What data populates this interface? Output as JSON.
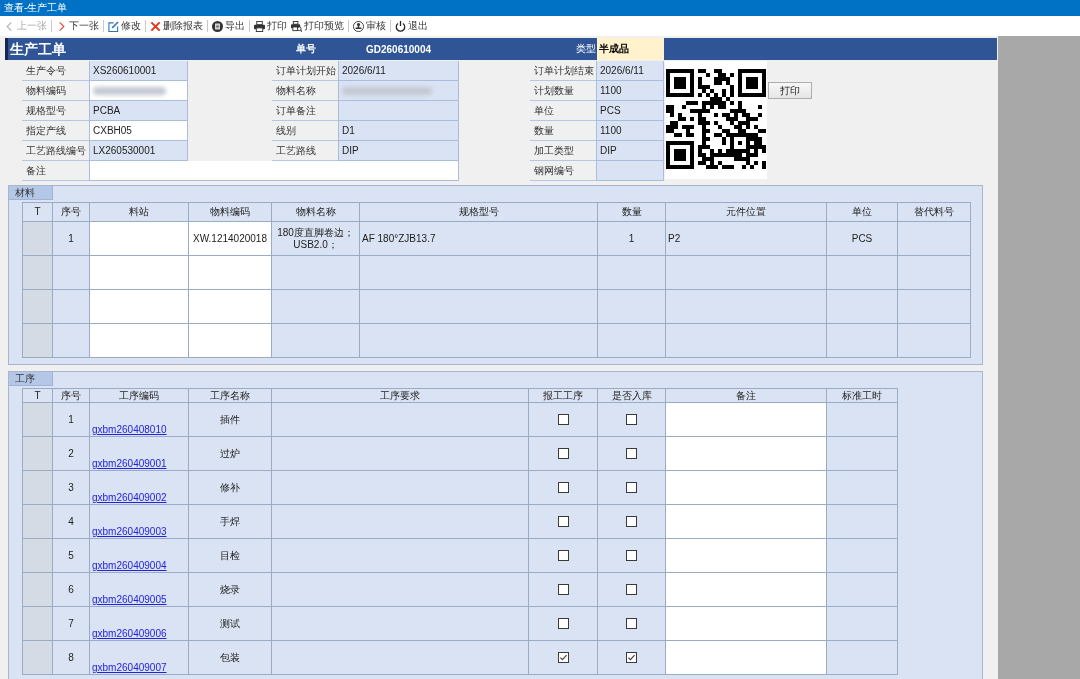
{
  "window": {
    "title": "查看-生产工单"
  },
  "toolbar": [
    {
      "label": "上一张",
      "disabled": true
    },
    {
      "label": "下一张",
      "disabled": false
    },
    {
      "label": "修改",
      "disabled": false
    },
    {
      "label": "删除报表",
      "disabled": false
    },
    {
      "label": "导出",
      "disabled": false
    },
    {
      "label": "打印",
      "disabled": false
    },
    {
      "label": "打印预览",
      "disabled": false
    },
    {
      "label": "审核",
      "disabled": false
    },
    {
      "label": "退出",
      "disabled": false
    }
  ],
  "header": {
    "title": "生产工单",
    "number_label": "单号",
    "number": "GD260610004",
    "type_label": "类型",
    "type": "半成品"
  },
  "form": {
    "rows": [
      {
        "fields": [
          {
            "label": "生产令号",
            "value": "XS260610001",
            "editable": false,
            "wide": false,
            "blurred": false
          },
          {
            "label": "订单计划开始",
            "value": "2026/6/11",
            "editable": false,
            "wide": false,
            "blurred": false
          },
          {
            "label": "订单计划结束",
            "value": "2026/6/11",
            "editable": false,
            "wide": false,
            "blurred": false
          }
        ]
      },
      {
        "fields": [
          {
            "label": "物料编码",
            "editable": true,
            "wide": false,
            "blurred": true
          },
          {
            "label": "物料名称",
            "editable": false,
            "wide": false,
            "blurred": true
          },
          {
            "label": "计划数量",
            "value": "1100",
            "editable": false,
            "wide": false,
            "blurred": false
          }
        ]
      },
      {
        "fields": [
          {
            "label": "规格型号",
            "value": "PCBA",
            "editable": false,
            "wide": false,
            "blurred": false
          },
          {
            "label": "订单备注",
            "editable": false,
            "wide": false,
            "blurred": false
          },
          {
            "label": "单位",
            "value": "PCS",
            "editable": false,
            "wide": false,
            "blurred": false
          }
        ]
      },
      {
        "fields": [
          {
            "label": "指定产线",
            "value": "CXBH05",
            "editable": true,
            "wide": false,
            "blurred": false
          },
          {
            "label": "线别",
            "value": "D1",
            "editable": false,
            "wide": false,
            "blurred": false
          },
          {
            "label": "数量",
            "value": "1100",
            "editable": false,
            "wide": false,
            "blurred": false
          }
        ]
      },
      {
        "fields": [
          {
            "label": "工艺路线编号",
            "value": "LX260530001",
            "editable": false,
            "wide": false,
            "blurred": false
          },
          {
            "label": "工艺路线",
            "value": "DIP",
            "editable": false,
            "wide": false,
            "blurred": false
          },
          {
            "label": "加工类型",
            "value": "DIP",
            "editable": false,
            "wide": false,
            "blurred": false
          }
        ]
      },
      {
        "fields": [
          {
            "label": "备注",
            "editable": true,
            "wide": true,
            "blurred": false
          },
          {
            "label": "钢网编号",
            "editable": false,
            "wide": false,
            "blurred": false
          }
        ]
      }
    ],
    "print_button": "打印"
  },
  "materials": {
    "tab": "材料",
    "columns": [
      {
        "label": "T",
        "kind": "marker"
      },
      {
        "label": "序号",
        "kind": "text"
      },
      {
        "label": "料站",
        "kind": "input"
      },
      {
        "label": "物料编码",
        "kind": "input"
      },
      {
        "label": "物料名称",
        "kind": "text"
      },
      {
        "label": "规格型号",
        "kind": "text"
      },
      {
        "label": "数量",
        "kind": "text"
      },
      {
        "label": "元件位置",
        "kind": "text"
      },
      {
        "label": "单位",
        "kind": "text"
      },
      {
        "label": "替代料号",
        "kind": "text"
      }
    ],
    "rows": [
      {
        "seq": "1",
        "code": "XW.1214020018",
        "name": "180度直脚卷边；USB2.0；",
        "spec": "AF 180°ZJB13.7",
        "qty": "1",
        "position": "P2",
        "unit": "PCS"
      },
      {},
      {},
      {}
    ]
  },
  "processes": {
    "tab": "工序",
    "columns": [
      {
        "label": "T",
        "kind": "marker"
      },
      {
        "label": "序号",
        "kind": "text"
      },
      {
        "label": "工序编码",
        "kind": "link"
      },
      {
        "label": "工序名称",
        "kind": "text"
      },
      {
        "label": "工序要求",
        "kind": "text"
      },
      {
        "label": "报工工序",
        "kind": "checkbox"
      },
      {
        "label": "是否入库",
        "kind": "checkbox"
      },
      {
        "label": "备注",
        "kind": "input"
      },
      {
        "label": "标准工时",
        "kind": "text"
      }
    ],
    "rows": [
      {
        "seq": "1",
        "code": "gxbm260408010",
        "name": "插件",
        "report": false,
        "stock": false
      },
      {
        "seq": "2",
        "code": "gxbm260409001",
        "name": "过炉",
        "report": false,
        "stock": false
      },
      {
        "seq": "3",
        "code": "gxbm260409002",
        "name": "修补",
        "report": false,
        "stock": false
      },
      {
        "seq": "4",
        "code": "gxbm260409003",
        "name": "手焊",
        "report": false,
        "stock": false
      },
      {
        "seq": "5",
        "code": "gxbm260409004",
        "name": "目检",
        "report": false,
        "stock": false
      },
      {
        "seq": "6",
        "code": "gxbm260409005",
        "name": "烧录",
        "report": false,
        "stock": false
      },
      {
        "seq": "7",
        "code": "gxbm260409006",
        "name": "测试",
        "report": false,
        "stock": false
      },
      {
        "seq": "8",
        "code": "gxbm260409007",
        "name": "包装",
        "report": true,
        "stock": true
      }
    ]
  }
}
